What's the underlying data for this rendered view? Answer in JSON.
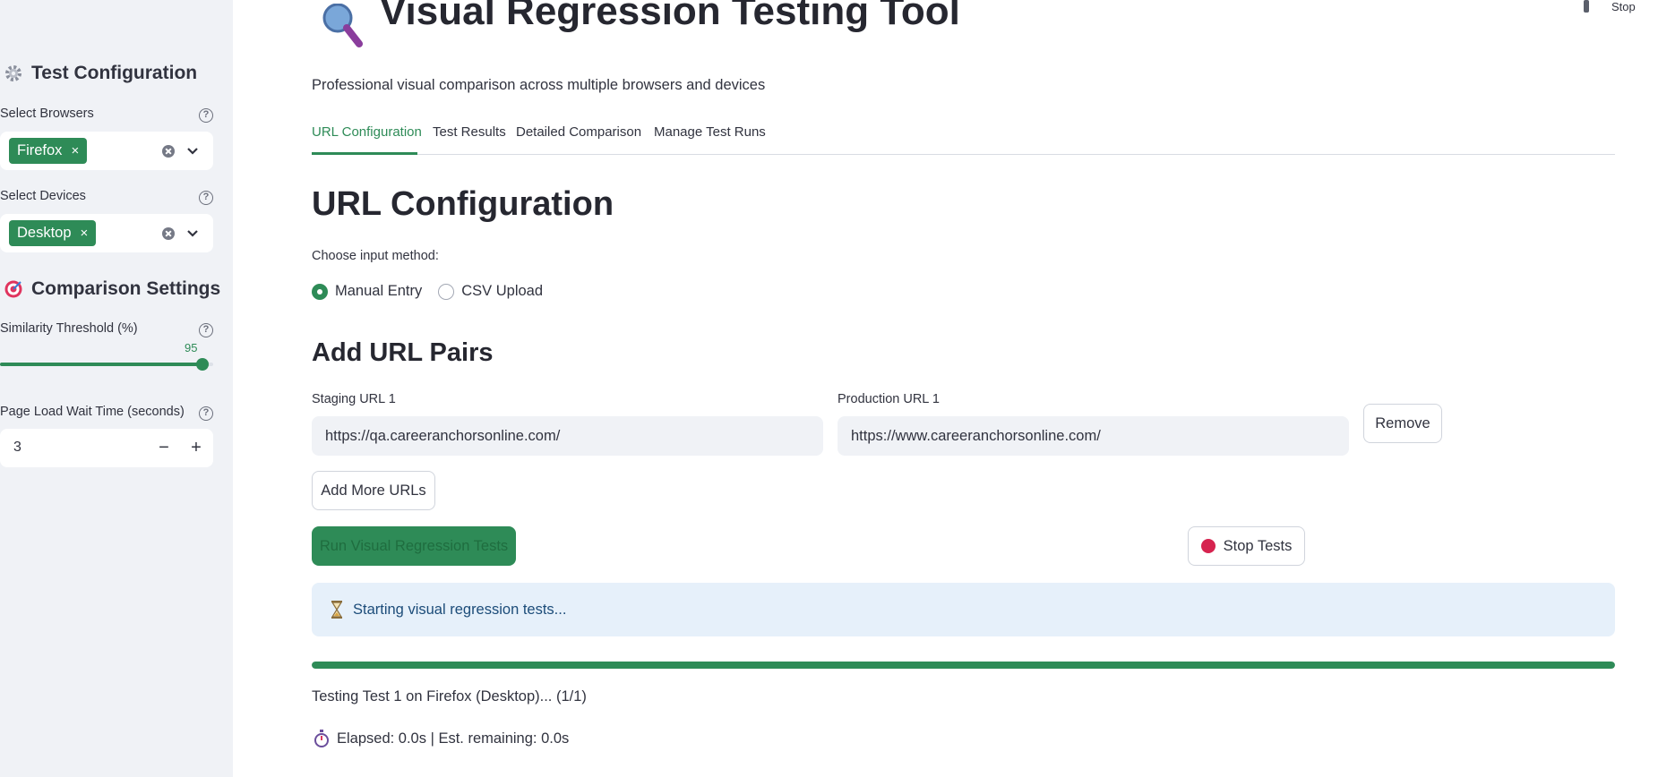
{
  "sidebar": {
    "test_config_heading": "Test Configuration",
    "browsers_label": "Select Browsers",
    "browsers_selected": "Firefox",
    "devices_label": "Select Devices",
    "devices_selected": "Desktop",
    "comparison_heading": "Comparison Settings",
    "threshold_label": "Similarity Threshold (%)",
    "threshold_value": "95",
    "threshold_fraction": 0.95,
    "wait_label": "Page Load Wait Time (seconds)",
    "wait_value": "3",
    "help_glyph": "?",
    "chip_remove_glyph": "×",
    "minus_glyph": "−",
    "plus_glyph": "+"
  },
  "header": {
    "title": "Visual Regression Testing Tool",
    "subtitle": "Professional visual comparison across multiple browsers and devices",
    "top_right_status": "Stop"
  },
  "tabs": [
    {
      "label": "URL Configuration"
    },
    {
      "label": "Test Results"
    },
    {
      "label": "Detailed Comparison"
    },
    {
      "label": "Manage Test Runs"
    }
  ],
  "main": {
    "section_title": "URL Configuration",
    "input_method_label": "Choose input method:",
    "radio_manual": "Manual Entry",
    "radio_csv": "CSV Upload",
    "url_pairs_title": "Add URL Pairs",
    "staging_label": "Staging URL 1",
    "staging_value": "https://qa.careeranchorsonline.com/",
    "production_label": "Production URL 1",
    "production_value": "https://www.careeranchorsonline.com/",
    "remove_label": "Remove",
    "add_more_label": "Add More URLs",
    "run_label": "Run Visual Regression Tests",
    "stop_label": "Stop Tests",
    "info_text": "Starting visual regression tests...",
    "progress_fraction": 1.0,
    "status_text": "Testing Test 1 on Firefox (Desktop)... (1/1)",
    "elapsed_text": "Elapsed: 0.0s | Est. remaining: 0.0s"
  },
  "colors": {
    "accent": "#2e8b57",
    "sidebar_bg": "#f0f2f6",
    "info_bg": "#e6f0fa",
    "stop_red": "#d6234f"
  },
  "icons": [
    "gear-icon",
    "target-icon",
    "magnifier-icon",
    "hourglass-icon",
    "stopwatch-icon",
    "help-icon",
    "clear-icon",
    "chevron-down-icon",
    "running-icon"
  ]
}
